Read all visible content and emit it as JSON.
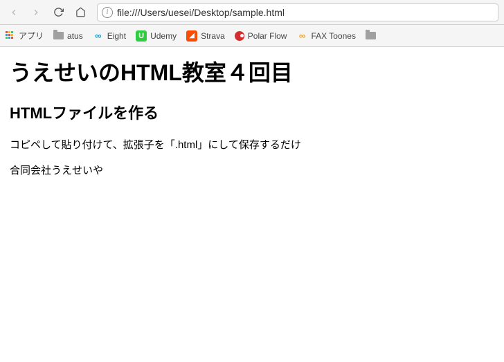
{
  "toolbar": {
    "url": "file:///Users/uesei/Desktop/sample.html"
  },
  "bookmarks": {
    "apps_label": "アプリ",
    "items": [
      {
        "label": "atus",
        "icon": "folder"
      },
      {
        "label": "Eight",
        "icon": "eight"
      },
      {
        "label": "Udemy",
        "icon": "udemy"
      },
      {
        "label": "Strava",
        "icon": "strava"
      },
      {
        "label": "Polar Flow",
        "icon": "polar"
      },
      {
        "label": "FAX Toones",
        "icon": "fax"
      }
    ]
  },
  "page": {
    "h1": "うえせいのHTML教室４回目",
    "h2": "HTMLファイルを作る",
    "p1": "コピペして貼り付けて、拡張子を「.html」にして保存するだけ",
    "p2": "合同会社うえせいや"
  }
}
